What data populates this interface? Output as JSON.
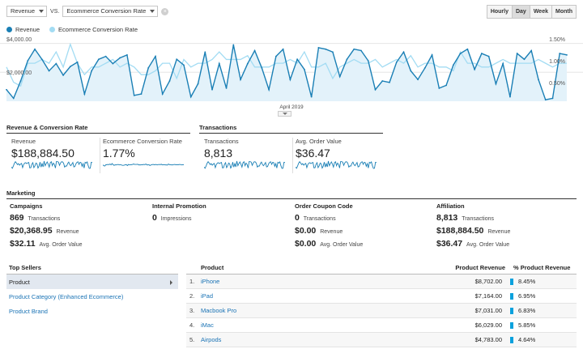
{
  "colors": {
    "primary": "#1a7fb5",
    "secondary": "#a3dcf3",
    "accent": "#0aa1dd"
  },
  "toolbar": {
    "metric1": "Revenue",
    "vs": "VS.",
    "metric2": "Ecommerce Conversion Rate",
    "clear_icon": "close-icon",
    "periods": [
      "Hourly",
      "Day",
      "Week",
      "Month"
    ],
    "active_period": "Day"
  },
  "legend": {
    "primary": "Revenue",
    "secondary": "Ecommerce Conversion Rate"
  },
  "chart_data": {
    "type": "line",
    "x_label": "April 2019",
    "y_left_ticks": [
      "$4,000.00",
      "$2,000.00"
    ],
    "y_right_ticks": [
      "1.50%",
      "1.00%",
      "0.50%"
    ],
    "y_left_range": [
      0,
      4200
    ],
    "y_right_range": [
      0,
      1.6
    ],
    "series": [
      {
        "name": "Revenue",
        "axis": "left",
        "values": [
          800,
          200,
          1400,
          2800,
          3600,
          2900,
          2100,
          2600,
          1800,
          2400,
          2700,
          500,
          2100,
          2900,
          3100,
          2600,
          3000,
          3200,
          400,
          500,
          2300,
          3100,
          500,
          1400,
          2900,
          2500,
          300,
          1200,
          3400,
          800,
          2600,
          900,
          3900,
          1500,
          2600,
          3500,
          2300,
          800,
          3100,
          3600,
          1500,
          2900,
          2200,
          300,
          3700,
          3600,
          3400,
          1700,
          2900,
          3600,
          3500,
          2800,
          800,
          1400,
          1300,
          2700,
          3400,
          2100,
          1500,
          2300,
          3200,
          900,
          1100,
          2500,
          3300,
          3600,
          2200,
          3300,
          3100,
          1200,
          2600,
          300,
          3300,
          2900,
          3500,
          1500,
          100,
          200,
          3300,
          3200
        ]
      },
      {
        "name": "Ecommerce Conversion Rate",
        "axis": "right",
        "values": [
          0.9,
          0.5,
          0.4,
          1.0,
          1.0,
          1.1,
          1.0,
          1.3,
          0.9,
          1.5,
          1.0,
          0.7,
          0.9,
          0.9,
          1.0,
          1.1,
          0.9,
          1.0,
          0.9,
          0.7,
          0.7,
          0.8,
          1.0,
          1.0,
          0.6,
          1.1,
          0.9,
          1.0,
          1.0,
          1.1,
          1.3,
          1.1,
          1.1,
          1.1,
          1.2,
          0.9,
          0.9,
          0.9,
          1.0,
          1.0,
          1.1,
          1.0,
          1.3,
          0.9,
          0.9,
          1.0,
          0.6,
          0.9,
          1.0,
          1.1,
          1.0,
          1.0,
          1.1,
          0.9,
          1.0,
          1.1,
          1.0,
          1.2,
          0.9,
          1.0,
          1.0,
          0.9,
          0.9,
          0.8,
          1.3,
          1.0,
          1.0,
          0.9,
          0.9,
          1.0,
          1.1,
          1.0,
          1.0,
          1.0,
          1.0,
          1.1,
          1.0,
          0.9,
          1.0,
          1.0
        ]
      }
    ]
  },
  "summary": {
    "left_title": "Revenue & Conversion Rate",
    "right_title": "Transactions",
    "metrics": [
      {
        "label": "Revenue",
        "value": "$188,884.50"
      },
      {
        "label": "Ecommerce Conversion Rate",
        "value": "1.77%"
      },
      {
        "label": "Transactions",
        "value": "8,813"
      },
      {
        "label": "Avg. Order Value",
        "value": "$36.47"
      }
    ]
  },
  "marketing": {
    "title": "Marketing",
    "columns": [
      {
        "heading": "Campaigns",
        "rows": [
          {
            "value": "869",
            "unit": "Transactions"
          },
          {
            "value": "$20,368.95",
            "unit": "Revenue"
          },
          {
            "value": "$32.11",
            "unit": "Avg. Order Value"
          }
        ]
      },
      {
        "heading": "Internal Promotion",
        "rows": [
          {
            "value": "0",
            "unit": "Impressions"
          }
        ]
      },
      {
        "heading": "Order Coupon Code",
        "rows": [
          {
            "value": "0",
            "unit": "Transactions"
          },
          {
            "value": "$0.00",
            "unit": "Revenue"
          },
          {
            "value": "$0.00",
            "unit": "Avg. Order Value"
          }
        ]
      },
      {
        "heading": "Affiliation",
        "rows": [
          {
            "value": "8,813",
            "unit": "Transactions"
          },
          {
            "value": "$188,884.50",
            "unit": "Revenue"
          },
          {
            "value": "$36.47",
            "unit": "Avg. Order Value"
          }
        ]
      }
    ]
  },
  "top_sellers": {
    "title": "Top Sellers",
    "items": [
      "Product",
      "Product Category (Enhanced Ecommerce)",
      "Product Brand"
    ],
    "selected": "Product"
  },
  "product_table": {
    "headers": [
      "Product",
      "Product Revenue",
      "% Product Revenue"
    ],
    "rows": [
      {
        "idx": "1.",
        "name": "iPhone",
        "revenue": "$8,702.00",
        "pct": "8.45%"
      },
      {
        "idx": "2.",
        "name": "iPad",
        "revenue": "$7,164.00",
        "pct": "6.95%"
      },
      {
        "idx": "3.",
        "name": "Macbook Pro",
        "revenue": "$7,031.00",
        "pct": "6.83%"
      },
      {
        "idx": "4.",
        "name": "iMac",
        "revenue": "$6,029.00",
        "pct": "5.85%"
      },
      {
        "idx": "5.",
        "name": "Airpods",
        "revenue": "$4,783.00",
        "pct": "4.64%"
      }
    ]
  }
}
